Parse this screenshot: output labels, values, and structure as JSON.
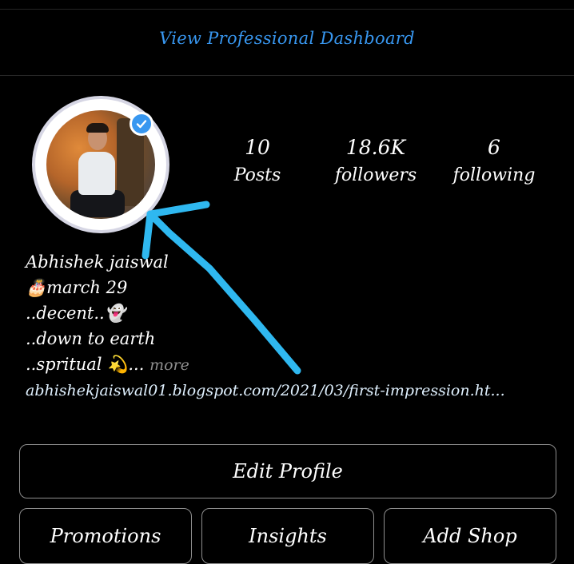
{
  "header": {
    "dashboard_link": "View Professional Dashboard"
  },
  "profile": {
    "avatar_alt": "profile-photo",
    "verified": true,
    "stats": {
      "posts_count": "10",
      "posts_label": "Posts",
      "followers_count": "18.6K",
      "followers_label": "followers",
      "following_count": "6",
      "following_label": "following"
    },
    "bio": {
      "name": "Abhishek jaiswal",
      "line_birthday": "🎂march 29",
      "line_decent": "..decent..👻",
      "line_earth": "..down to earth",
      "line_spritual": "..spritual 💫...",
      "more": "more",
      "link": "abhishekjaiswal01.blogspot.com/2021/03/first-impression.ht..."
    }
  },
  "buttons": {
    "edit_profile": "Edit Profile",
    "promotions": "Promotions",
    "insights": "Insights",
    "add_shop": "Add Shop"
  },
  "colors": {
    "background": "#000000",
    "accent_blue": "#3897f0",
    "annotation_arrow": "#2fb8f0"
  }
}
